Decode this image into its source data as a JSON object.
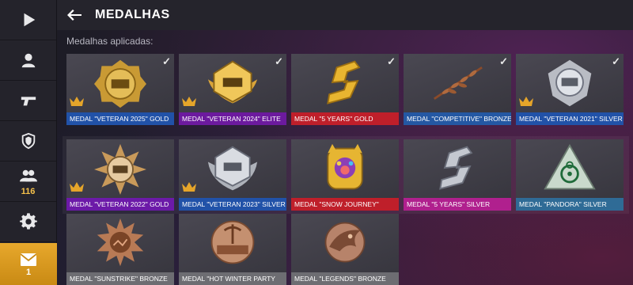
{
  "header": {
    "title": "MEDALHAS"
  },
  "subtitle": "Medalhas aplicadas:",
  "sidebar": {
    "friends_count": "116",
    "mail_count": "1"
  },
  "colors": {
    "gold": "#1f4fa0",
    "elite": "#6a1b9a",
    "red": "#b8222c",
    "blue": "#1f5e9c",
    "purple": "#6a1fb0",
    "pink": "#b5288e",
    "teal": "#2f6b96",
    "gray": "#6d6d72"
  },
  "medals": [
    {
      "label": "MEDAL \"VETERAN 2025\" GOLD",
      "color": "#2152a8",
      "checked": true,
      "crown": true,
      "art": "gold-2025"
    },
    {
      "label": "MEDAL \"VETERAN 2024\" ELITE",
      "color": "#6c1a9e",
      "checked": true,
      "crown": true,
      "art": "elite-2024"
    },
    {
      "label": "MEDAL \"5 YEARS\" GOLD",
      "color": "#bf1f2a",
      "checked": true,
      "crown": false,
      "art": "five-gold"
    },
    {
      "label": "MEDAL \"COMPETITIVE\" BRONZE",
      "color": "#2458a3",
      "checked": true,
      "crown": false,
      "art": "laurel"
    },
    {
      "label": "MEDAL \"VETERAN 2021\" SILVER",
      "color": "#2152a8",
      "checked": true,
      "crown": true,
      "art": "silver-2021"
    },
    {
      "label": "MEDAL \"VETERAN 2022\" GOLD",
      "color": "#6c1aa8",
      "checked": false,
      "crown": true,
      "art": "gold-2022"
    },
    {
      "label": "MEDAL \"VETERAN 2023\" SILVER",
      "color": "#2152a8",
      "checked": false,
      "crown": true,
      "art": "silver-2023"
    },
    {
      "label": "MEDAL \"SNOW JOURNEY\"",
      "color": "#bf1f2a",
      "checked": false,
      "crown": false,
      "art": "snow"
    },
    {
      "label": "MEDAL \"5 YEARS\" SILVER",
      "color": "#b0208e",
      "checked": false,
      "crown": false,
      "art": "five-silver"
    },
    {
      "label": "MEDAL \"PANDORA\" SILVER",
      "color": "#2f6b96",
      "checked": false,
      "crown": false,
      "art": "pandora"
    },
    {
      "label": "MEDAL \"SUNSTRIKE\" BRONZE",
      "color": "#6d6d72",
      "checked": false,
      "crown": false,
      "art": "sunstrike"
    },
    {
      "label": "MEDAL \"HOT WINTER PARTY",
      "color": "#6d6d72",
      "checked": false,
      "crown": false,
      "art": "party"
    },
    {
      "label": "MEDAL \"LEGENDS\" BRONZE",
      "color": "#6d6d72",
      "checked": false,
      "crown": false,
      "art": "legends"
    }
  ]
}
